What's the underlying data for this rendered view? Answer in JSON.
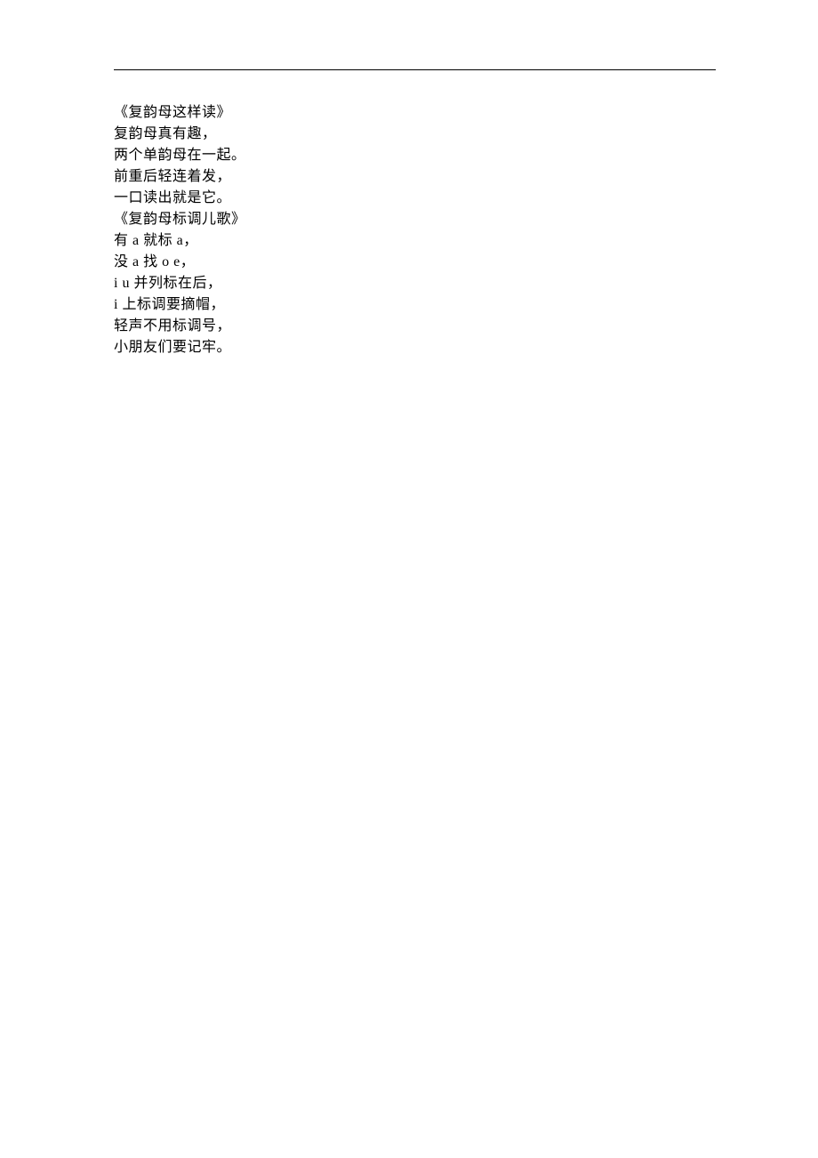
{
  "lines": [
    "《复韵母这样读》",
    "复韵母真有趣，",
    "两个单韵母在一起。",
    "前重后轻连着发，",
    "一口读出就是它。",
    "《复韵母标调儿歌》",
    "有 a 就标 a，",
    "没 a 找 o e，",
    "i u 并列标在后，",
    "i 上标调要摘帽，",
    "轻声不用标调号，",
    "小朋友们要记牢。"
  ]
}
